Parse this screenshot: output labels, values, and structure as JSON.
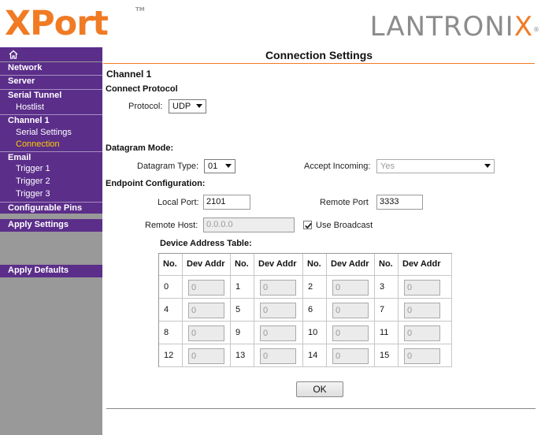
{
  "brand": {
    "product": "XPort",
    "product_tm": "TM",
    "company_main": "LANTRONI",
    "company_x": "X",
    "company_reg": "®",
    "accent_color": "#f07b24",
    "nav_color": "#5b2e8a"
  },
  "sidebar": {
    "home_icon": "home-icon",
    "items": [
      {
        "label": "Network",
        "type": "section"
      },
      {
        "label": "Server",
        "type": "section"
      },
      {
        "label": "Serial Tunnel",
        "type": "section"
      },
      {
        "label": "Hostlist",
        "type": "sub"
      },
      {
        "label": "Channel 1",
        "type": "section"
      },
      {
        "label": "Serial Settings",
        "type": "sub"
      },
      {
        "label": "Connection",
        "type": "sub",
        "active": true
      },
      {
        "label": "Email",
        "type": "section"
      },
      {
        "label": "Trigger 1",
        "type": "sub"
      },
      {
        "label": "Trigger 2",
        "type": "sub"
      },
      {
        "label": "Trigger 3",
        "type": "sub"
      },
      {
        "label": "Configurable Pins",
        "type": "section"
      },
      {
        "label": "Apply Settings",
        "type": "section"
      },
      {
        "label": "Apply Defaults",
        "type": "section"
      }
    ]
  },
  "page": {
    "title": "Connection Settings",
    "channel": "Channel 1",
    "connect_protocol": "Connect Protocol",
    "protocol_label": "Protocol:",
    "protocol_value": "UDP",
    "datagram_mode": "Datagram Mode:",
    "datagram_type_label": "Datagram Type:",
    "datagram_type_value": "01",
    "accept_incoming_label": "Accept Incoming:",
    "accept_incoming_value": "Yes",
    "endpoint_config": "Endpoint Configuration:",
    "local_port_label": "Local Port:",
    "local_port_value": "2101",
    "remote_port_label": "Remote Port",
    "remote_port_value": "3333",
    "remote_host_label": "Remote Host:",
    "remote_host_value": "0.0.0.0",
    "use_broadcast_label": "Use Broadcast",
    "use_broadcast_checked": true,
    "device_table_title": "Device Address Table:",
    "ok_label": "OK"
  },
  "device_table": {
    "headers": [
      "No.",
      "Dev Addr",
      "No.",
      "Dev Addr",
      "No.",
      "Dev Addr",
      "No.",
      "Dev Addr"
    ],
    "rows": [
      [
        {
          "no": "0",
          "addr": "0"
        },
        {
          "no": "1",
          "addr": "0"
        },
        {
          "no": "2",
          "addr": "0"
        },
        {
          "no": "3",
          "addr": "0"
        }
      ],
      [
        {
          "no": "4",
          "addr": "0"
        },
        {
          "no": "5",
          "addr": "0"
        },
        {
          "no": "6",
          "addr": "0"
        },
        {
          "no": "7",
          "addr": "0"
        }
      ],
      [
        {
          "no": "8",
          "addr": "0"
        },
        {
          "no": "9",
          "addr": "0"
        },
        {
          "no": "10",
          "addr": "0"
        },
        {
          "no": "11",
          "addr": "0"
        }
      ],
      [
        {
          "no": "12",
          "addr": "0"
        },
        {
          "no": "13",
          "addr": "0"
        },
        {
          "no": "14",
          "addr": "0"
        },
        {
          "no": "15",
          "addr": "0"
        }
      ]
    ]
  }
}
